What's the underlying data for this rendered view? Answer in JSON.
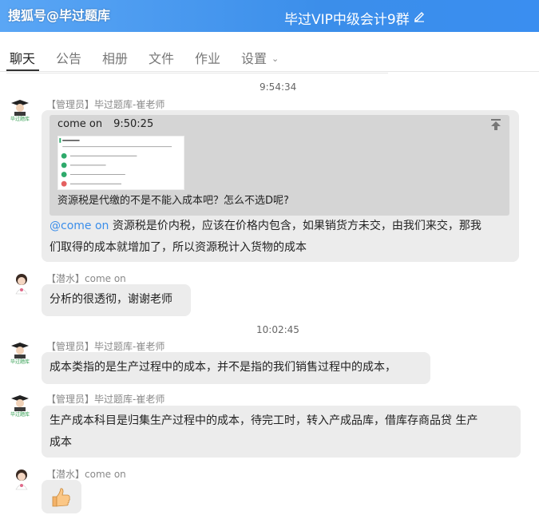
{
  "header": {
    "watermark": "搜狐号@毕过题库",
    "group_title": "毕过VIP中级会计9群",
    "edit_icon": "edit-pencil-icon"
  },
  "tabs": [
    {
      "label": "聊天",
      "active": true
    },
    {
      "label": "公告"
    },
    {
      "label": "相册"
    },
    {
      "label": "文件"
    },
    {
      "label": "作业"
    },
    {
      "label": "设置"
    }
  ],
  "times": [
    "9:54:34",
    "10:02:45"
  ],
  "messages": [
    {
      "sender": "【管理员】毕过题库-崔老师",
      "quote": {
        "name": "come on",
        "time": "9:50:25",
        "question": "资源税是代缴的不是不能入成本吧？怎么不选D呢?"
      },
      "mention": "@come on",
      "line1": " 资源税是价内税，应该在价格内包含，如果销货方未交，由我们来交，那我",
      "line2": "们取得的成本就增加了，所以资源税计入货物的成本"
    },
    {
      "sender": "【潜水】come on",
      "text": "分析的很透彻，谢谢老师"
    },
    {
      "sender": "【管理员】毕过题库-崔老师",
      "text": "成本类指的是生产过程中的成本，并不是指的我们销售过程中的成本，"
    },
    {
      "sender": "【管理员】毕过题库-崔老师",
      "line1": "生产成本科目是归集生产过程中的成本，待完工时，转入产成品库，借库存商品贷  生产",
      "line2": "成本"
    },
    {
      "sender": "【潜水】come on",
      "emoji": "thumbs-up-emoji"
    }
  ],
  "colors": {
    "accent": "#3b8eea",
    "bubble": "#ececec",
    "quote": "#d5d5d5"
  }
}
